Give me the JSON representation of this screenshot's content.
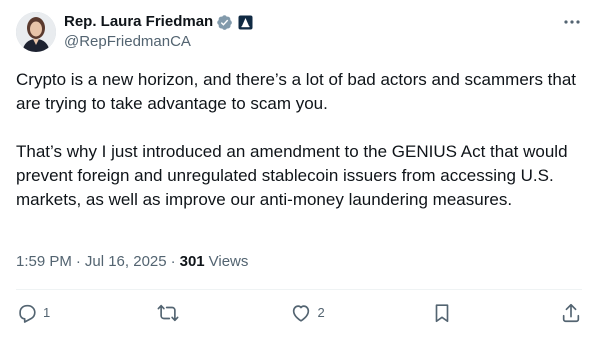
{
  "author": {
    "display_name": "Rep. Laura Friedman",
    "handle": "@RepFriedmanCA",
    "avatar_icon": "profile-photo",
    "verified_icon": "verified-badge-icon",
    "affiliation_icon": "government-badge-icon"
  },
  "tweet": {
    "paragraphs": [
      "Crypto is a new horizon, and there’s a lot of bad actors and scammers that are trying to take advantage to scam you.",
      "That’s why I just introduced an amendment to the GENIUS Act that would prevent foreign and unregulated stablecoin issuers from accessing U.S. markets, as well as improve our anti-money laundering measures."
    ],
    "time": "1:59 PM",
    "date": "Jul 16, 2025",
    "views_count": "301",
    "views_label": "Views"
  },
  "actions": {
    "reply_count": "1",
    "retweet_count": "",
    "like_count": "2"
  },
  "colors": {
    "text": "#0f1419",
    "secondary": "#536471",
    "verified": "#829aab",
    "divider": "#eff3f4"
  }
}
